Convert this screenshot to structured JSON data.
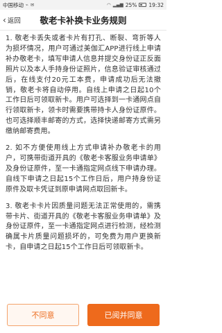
{
  "status_bar": {
    "carrier": "中国移动",
    "battery": "25%",
    "time": "19:32"
  },
  "header": {
    "back_label": "返回",
    "title": "敬老卡补换卡业务规则"
  },
  "rules": [
    "1. 敬老卡丢失或者卡片有打孔、断裂、弯折等人为损坏情况，用户可通过美伽汇APP进行线上申请补办敬老卡，填写申请人信息并提交身份证正反面照片以及本人手持身份证照片，信息验证审核通过后，在线支付20元工本费，申请成功后无法撤销，敬老卡将自动停用。自线上申请之日起10个工作日后可领取新卡。用户可选择到一卡通网点自行领取新卡，领卡时需要携带持卡人身份证原件。也可选择顺丰邮寄的方式，选择快递邮寄方式需另缴纳邮寄费用。",
    "2. 如不方便使用线上方式申请补办敬老卡的用户，可携带街道开具的《敬老卡客服业务申请单》及身份证原件，至一卡通指定网点线下申请办理。自线下申请之日起15个工作日后，用户持身份证原件及取卡凭证到原申请网点取回新卡。",
    "3. 敬老卡卡片因质量问题无法正常使用的，需携带卡片、街道开具的《敬老卡客服业务申请单》及身份证原件，至一卡通指定网点进行检测，经检测确属卡片质量问题损坏的，可免费为用户更换新卡，自申请之日起15个工作日后可领取新卡。"
  ],
  "footer": {
    "disagree_label": "不同意",
    "agree_label": "已阅并同意"
  },
  "colors": {
    "accent": "#ee6a1c",
    "accent_light": "#fff7f1"
  }
}
